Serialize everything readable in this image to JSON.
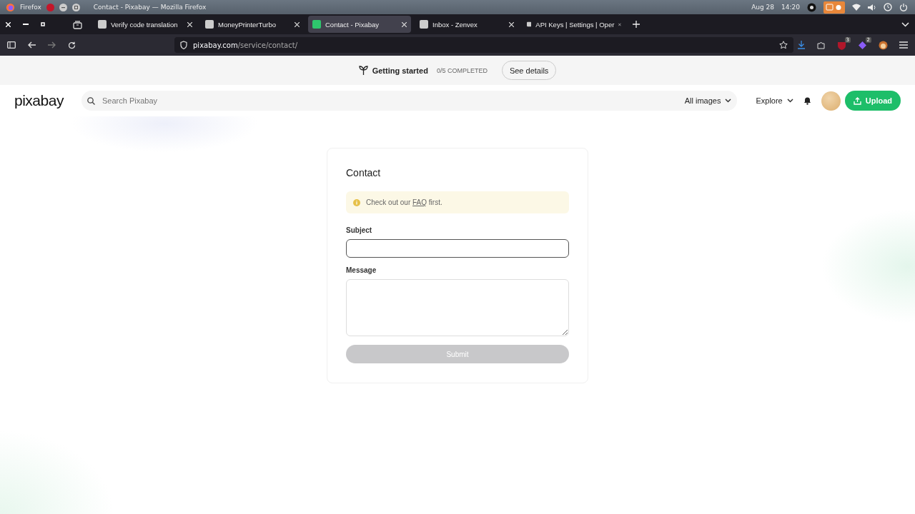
{
  "os_bar": {
    "app": "Firefox",
    "title": "Contact - Pixabay — Mozilla Firefox",
    "date": "Aug 28",
    "time": "14:20"
  },
  "tabs": [
    {
      "label": "Verify code translation",
      "selected": false
    },
    {
      "label": "MoneyPrinterTurbo",
      "selected": false
    },
    {
      "label": "Contact - Pixabay",
      "selected": true
    },
    {
      "label": "Inbox - Zenvex",
      "selected": false
    },
    {
      "label": "API Keys | Settings | Oper",
      "selected": false
    }
  ],
  "address_bar": {
    "domain": "pixabay.com",
    "path": "/service/contact/"
  },
  "extension_badges": [
    "3",
    "2"
  ],
  "onboarding": {
    "label": "Getting started",
    "progress": "0/5 COMPLETED",
    "button": "See details"
  },
  "header": {
    "logo": "pixabay",
    "search_placeholder": "Search Pixabay",
    "filter": "All images",
    "explore": "Explore",
    "upload": "Upload"
  },
  "form": {
    "title": "Contact",
    "notice": {
      "before": "Check out our",
      "link": "FAQ",
      "after": "first."
    },
    "fields": [
      {
        "label": "Subject",
        "kind": "input",
        "focused": true
      },
      {
        "label": "Message",
        "kind": "textarea",
        "focused": false
      }
    ],
    "submit": {
      "label": "Submit",
      "disabled": true
    }
  }
}
